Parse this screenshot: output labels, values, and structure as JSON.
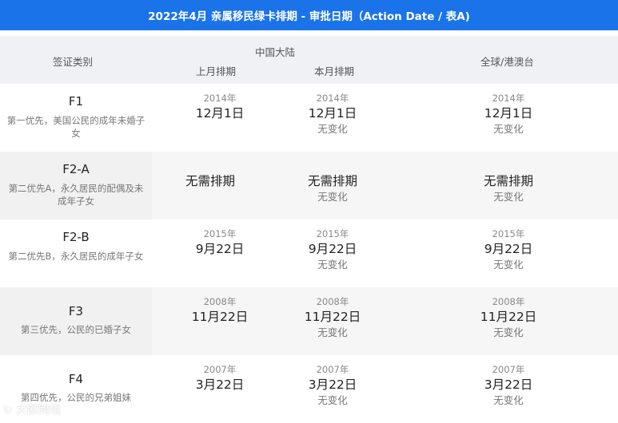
{
  "title": "2022年4月 亲属移民绿卡排期 - 审批日期（Action Date / 表A)",
  "header": {
    "category": "签证类别",
    "china": "中国大陆",
    "last_month": "上月排期",
    "this_month": "本月排期",
    "global": "全球/港澳台"
  },
  "rows": [
    {
      "code": "F1",
      "desc": "第一优先，美国公民的成年未婚子女",
      "last": {
        "year": "2014年",
        "date": "12月1日"
      },
      "this": {
        "year": "2014年",
        "date": "12月1日",
        "change": "无变化"
      },
      "global": {
        "year": "2014年",
        "date": "12月1日",
        "change": "无变化"
      }
    },
    {
      "code": "F2-A",
      "desc": "第二优先A，永久居民的配偶及未成年子女",
      "last": {
        "year": "",
        "date": "无需排期"
      },
      "this": {
        "year": "",
        "date": "无需排期",
        "change": "无变化"
      },
      "global": {
        "year": "",
        "date": "无需排期",
        "change": "无变化"
      }
    },
    {
      "code": "F2-B",
      "desc": "第二优先B，永久居民的成年子女",
      "last": {
        "year": "2015年",
        "date": "9月22日"
      },
      "this": {
        "year": "2015年",
        "date": "9月22日",
        "change": "无变化"
      },
      "global": {
        "year": "2015年",
        "date": "9月22日",
        "change": "无变化"
      }
    },
    {
      "code": "F3",
      "desc": "第三优先，公民的已婚子女",
      "last": {
        "year": "2008年",
        "date": "11月22日"
      },
      "this": {
        "year": "2008年",
        "date": "11月22日",
        "change": "无变化"
      },
      "global": {
        "year": "2008年",
        "date": "11月22日",
        "change": "无变化"
      }
    },
    {
      "code": "F4",
      "desc": "第四优先，公民的兄弟姐妹",
      "last": {
        "year": "2007年",
        "date": "3月22日"
      },
      "this": {
        "year": "2007年",
        "date": "3月22日",
        "change": "无变化"
      },
      "global": {
        "year": "2007年",
        "date": "3月22日",
        "change": "无变化"
      }
    }
  ],
  "watermark": "大欧跨境",
  "colors": {
    "title_bg": "#1a73e8",
    "header_bg": "#f0f1f5",
    "alt_row_bg": "#f6f6f6"
  }
}
